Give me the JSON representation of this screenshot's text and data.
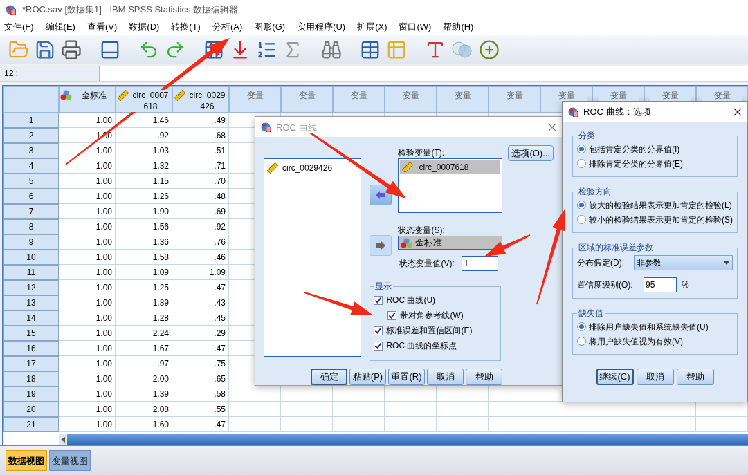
{
  "window": {
    "title": "*ROC.sav [数据集1] - IBM SPSS Statistics 数据编辑器"
  },
  "menu": [
    {
      "label": "文件(F)"
    },
    {
      "label": "编辑(E)"
    },
    {
      "label": "查看(V)"
    },
    {
      "label": "数据(D)"
    },
    {
      "label": "转换(T)"
    },
    {
      "label": "分析(A)"
    },
    {
      "label": "图形(G)"
    },
    {
      "label": "实用程序(U)"
    },
    {
      "label": "扩展(X)"
    },
    {
      "label": "窗口(W)"
    },
    {
      "label": "帮助(H)"
    }
  ],
  "cell_ref": "12 :",
  "grid": {
    "columns": [
      {
        "label": "金标准",
        "kind": "nominal"
      },
      {
        "label": "circ_0007618",
        "kind": "scale"
      },
      {
        "label": "circ_0029426",
        "kind": "scale"
      },
      {
        "label": "变量",
        "kind": "empty"
      },
      {
        "label": "变量",
        "kind": "empty"
      },
      {
        "label": "变量",
        "kind": "empty"
      },
      {
        "label": "变量",
        "kind": "empty"
      },
      {
        "label": "变量",
        "kind": "empty"
      },
      {
        "label": "变量",
        "kind": "empty"
      },
      {
        "label": "变量",
        "kind": "empty"
      },
      {
        "label": "变量",
        "kind": "empty"
      },
      {
        "label": "变量",
        "kind": "empty"
      },
      {
        "label": "变量",
        "kind": "empty"
      }
    ],
    "rows": [
      {
        "number": "1",
        "cells": [
          "1.00",
          "1.46",
          ".49"
        ]
      },
      {
        "number": "2",
        "cells": [
          "1.00",
          ".92",
          ".68"
        ]
      },
      {
        "number": "3",
        "cells": [
          "1.00",
          "1.03",
          ".51"
        ]
      },
      {
        "number": "4",
        "cells": [
          "1.00",
          "1.32",
          ".71"
        ]
      },
      {
        "number": "5",
        "cells": [
          "1.00",
          "1.15",
          ".70"
        ]
      },
      {
        "number": "6",
        "cells": [
          "1.00",
          "1.26",
          ".48"
        ]
      },
      {
        "number": "7",
        "cells": [
          "1.00",
          "1.90",
          ".69"
        ]
      },
      {
        "number": "8",
        "cells": [
          "1.00",
          "1.56",
          ".92"
        ]
      },
      {
        "number": "9",
        "cells": [
          "1.00",
          "1.36",
          ".76"
        ]
      },
      {
        "number": "10",
        "cells": [
          "1.00",
          "1.58",
          ".46"
        ]
      },
      {
        "number": "11",
        "cells": [
          "1.00",
          "1.09",
          "1.09"
        ]
      },
      {
        "number": "12",
        "cells": [
          "1.00",
          "1.25",
          ".47"
        ]
      },
      {
        "number": "13",
        "cells": [
          "1.00",
          "1.89",
          ".43"
        ]
      },
      {
        "number": "14",
        "cells": [
          "1.00",
          "1.28",
          ".45"
        ]
      },
      {
        "number": "15",
        "cells": [
          "1.00",
          "2.24",
          ".29"
        ]
      },
      {
        "number": "16",
        "cells": [
          "1.00",
          "1.67",
          ".47"
        ]
      },
      {
        "number": "17",
        "cells": [
          "1.00",
          ".97",
          ".75"
        ]
      },
      {
        "number": "18",
        "cells": [
          "1.00",
          "2.00",
          ".65"
        ]
      },
      {
        "number": "19",
        "cells": [
          "1.00",
          "1.39",
          ".58"
        ]
      },
      {
        "number": "20",
        "cells": [
          "1.00",
          "2.08",
          ".55"
        ]
      },
      {
        "number": "21",
        "cells": [
          "1.00",
          "1.60",
          ".47"
        ]
      }
    ]
  },
  "tabs": [
    {
      "label": "数据视图",
      "selected": true
    },
    {
      "label": "变量视图",
      "selected": false
    }
  ],
  "roc_dialog": {
    "title": "ROC 曲线",
    "source_list": [
      {
        "name": "circ_0029426",
        "kind": "scale"
      }
    ],
    "test_label": "检验变量(T):",
    "test_vars": [
      {
        "name": "circ_0007618",
        "kind": "scale"
      }
    ],
    "options_button": "选项(O)...",
    "state_label": "状态变量(S):",
    "state_var": {
      "name": "金标准",
      "kind": "nominal"
    },
    "state_value_label": "状态变量值(V):",
    "state_value": "1",
    "display": {
      "title": "显示",
      "items": [
        {
          "label": "ROC 曲线(U)",
          "checked": true,
          "children": [
            {
              "label": "带对角参考线(W)",
              "checked": true
            }
          ]
        },
        {
          "label": "标准误差和置信区间(E)",
          "checked": true
        },
        {
          "label": "ROC 曲线的坐标点",
          "checked": true
        }
      ]
    },
    "buttons": [
      {
        "label": "确定",
        "default": true
      },
      {
        "label": "粘贴(P)",
        "default": false
      },
      {
        "label": "重置(R)",
        "default": false
      },
      {
        "label": "取消",
        "default": false
      },
      {
        "label": "帮助",
        "default": false
      }
    ]
  },
  "options_dialog": {
    "title": "ROC 曲线：选项",
    "groups": [
      {
        "title": "分类",
        "kind": "radio",
        "options": [
          {
            "label": "包括肯定分类的分界值(I)",
            "selected": true
          },
          {
            "label": "排除肯定分类的分界值(E)",
            "selected": false
          }
        ]
      },
      {
        "title": "检验方向",
        "kind": "radio",
        "options": [
          {
            "label": "较大的检验结果表示更加肯定的检验(L)",
            "selected": true
          },
          {
            "label": "较小的检验结果表示更加肯定的检验(S)",
            "selected": false
          }
        ]
      },
      {
        "title": "区域的标准误差参数",
        "kind": "fields",
        "distribution_label": "分布假定(D):",
        "distribution_value": "非参数",
        "confidence_label": "置信度级别(O):",
        "confidence_value": "95",
        "unit": "%"
      },
      {
        "title": "缺失值",
        "kind": "radio",
        "options": [
          {
            "label": "排除用户缺失值和系统缺失值(U)",
            "selected": true
          },
          {
            "label": "将用户缺失值视为有效(V)",
            "selected": false
          }
        ]
      }
    ],
    "buttons": [
      {
        "label": "继续(C)",
        "default": true
      },
      {
        "label": "取消",
        "default": false
      },
      {
        "label": "帮助",
        "default": false
      }
    ]
  }
}
